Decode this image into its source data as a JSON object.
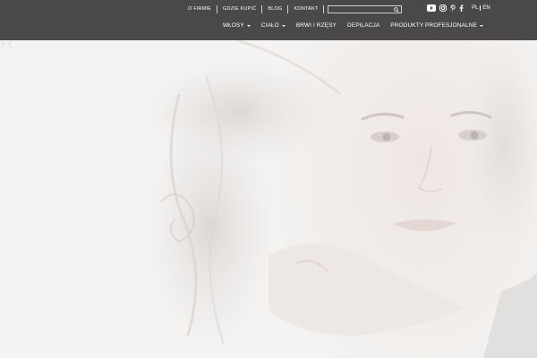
{
  "top_nav": {
    "items": [
      "O FIRMIE",
      "GDZIE KUPIĆ",
      "BLOG",
      "KONTAKT"
    ]
  },
  "search": {
    "placeholder": "",
    "value": ""
  },
  "social": [
    "youtube-icon",
    "instagram-icon",
    "pinterest-icon",
    "facebook-icon"
  ],
  "lang": {
    "pl": "PL",
    "en": "EN"
  },
  "main_nav": {
    "items": [
      {
        "label": "WŁOSY",
        "dropdown": true
      },
      {
        "label": "CIAŁO",
        "dropdown": true
      },
      {
        "label": "BRWI I RZĘSY",
        "dropdown": false
      },
      {
        "label": "DEPILACJA",
        "dropdown": false
      },
      {
        "label": "PRODUKTY PROFESJONALNE",
        "dropdown": true
      }
    ]
  },
  "colors": {
    "header_bg": "#4a4848",
    "text": "#ffffff",
    "hero_bg": "#f3f2f1"
  },
  "hero": {
    "image": "woman-portrait-image"
  }
}
